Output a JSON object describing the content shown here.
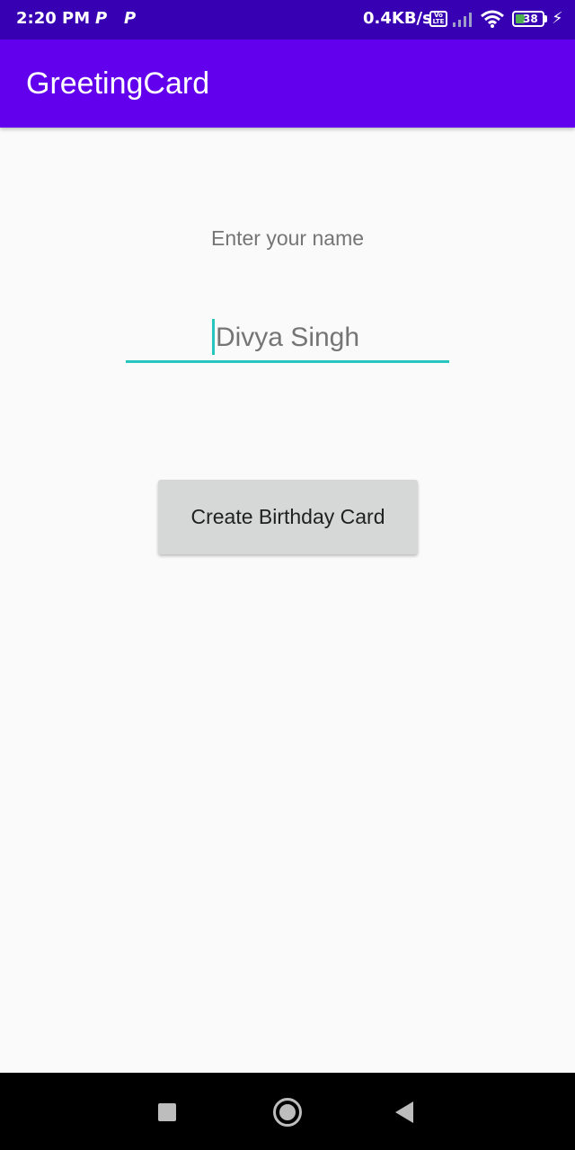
{
  "status_bar": {
    "time": "2:20 PM",
    "app_icons": [
      "P",
      "P"
    ],
    "network_speed": "0.4KB/s",
    "volte_label": "Vo LTE",
    "battery_level": "38",
    "icons": [
      "volte-icon",
      "signal-icon",
      "wifi-icon",
      "battery-icon",
      "charging-icon"
    ]
  },
  "app_bar": {
    "title": "GreetingCard"
  },
  "main": {
    "prompt_label": "Enter your name",
    "name_input": {
      "value": "",
      "placeholder": "Divya Singh"
    },
    "create_button_label": "Create Birthday Card"
  },
  "nav_bar": {
    "icons": [
      "recents-icon",
      "home-icon",
      "back-icon"
    ]
  },
  "colors": {
    "status_bar": "#3700b3",
    "app_bar": "#6200ee",
    "accent": "#26c6bf",
    "button_bg": "#d6d7d7",
    "background": "#fafafa"
  }
}
